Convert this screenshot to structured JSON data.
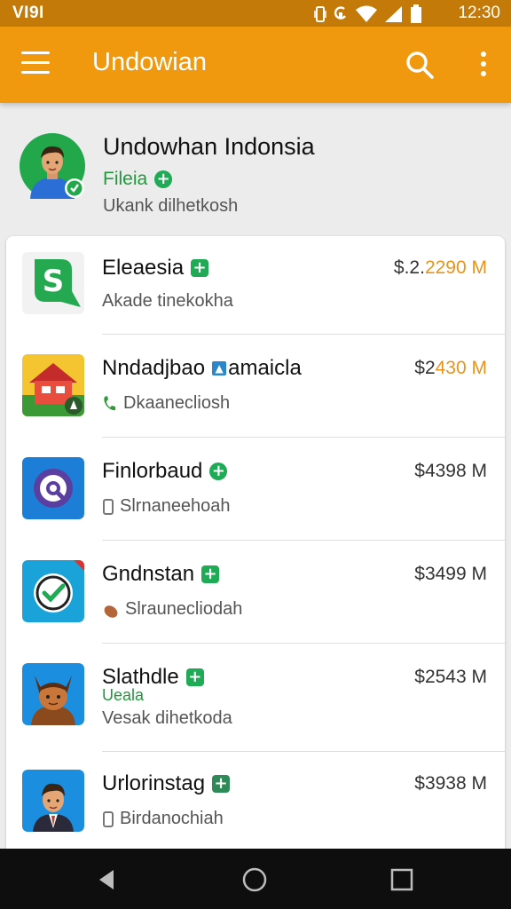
{
  "status_bar": {
    "carrier": "VI9I",
    "time": "12:30",
    "icons": [
      "vibrate-icon",
      "sync-icon",
      "wifi-icon",
      "signal-icon",
      "battery-icon"
    ]
  },
  "app_bar": {
    "title": "Undowian",
    "icons": [
      "menu-icon",
      "search-icon",
      "more-vert-icon"
    ]
  },
  "profile": {
    "name": "Undowhan Indonsia",
    "subtitle": "Fileia",
    "description": "Ukank dilhetkosh"
  },
  "apps": [
    {
      "name": "Eleaesia",
      "tag": "",
      "description": "Akade tinekokha",
      "desc_icon": "",
      "price_main": "$.2.",
      "price_accent": "2290 M",
      "icon": "s-logo-icon"
    },
    {
      "name": "Nndadjbao",
      "name_suffix": "amaicla",
      "tag": "",
      "description": "Dkaanecliosh",
      "desc_icon": "phone-icon",
      "price_main": "$2",
      "price_accent": "430 M",
      "icon": "house-icon"
    },
    {
      "name": "Finlorbaud",
      "tag": "",
      "description": "Slrnaneehoah",
      "desc_icon": "device-icon",
      "price_main": "$4398 M",
      "price_accent": "",
      "icon": "q-circle-icon"
    },
    {
      "name": "Gndnstan",
      "tag": "",
      "description": "Slraunecliodah",
      "desc_icon": "bag-icon",
      "price_main": "$3499 M",
      "price_accent": "",
      "icon": "check-circle-icon"
    },
    {
      "name": "Slathdle",
      "tag": "Ueala",
      "description": "Vesak dihetkoda",
      "desc_icon": "",
      "price_main": "$2543 M",
      "price_accent": "",
      "icon": "fox-avatar-icon"
    },
    {
      "name": "Urlorinstag",
      "tag": "",
      "description": "Birdanochiah",
      "desc_icon": "device-icon",
      "price_main": "$3938 M",
      "price_accent": "",
      "icon": "man-avatar-icon"
    }
  ],
  "nav_bar": {
    "buttons": [
      "back-icon",
      "home-icon",
      "recents-icon"
    ]
  },
  "colors": {
    "status_bar": "#c47a08",
    "app_bar": "#f0990f",
    "accent_green": "#1faa55",
    "price_accent": "#e9931a"
  }
}
